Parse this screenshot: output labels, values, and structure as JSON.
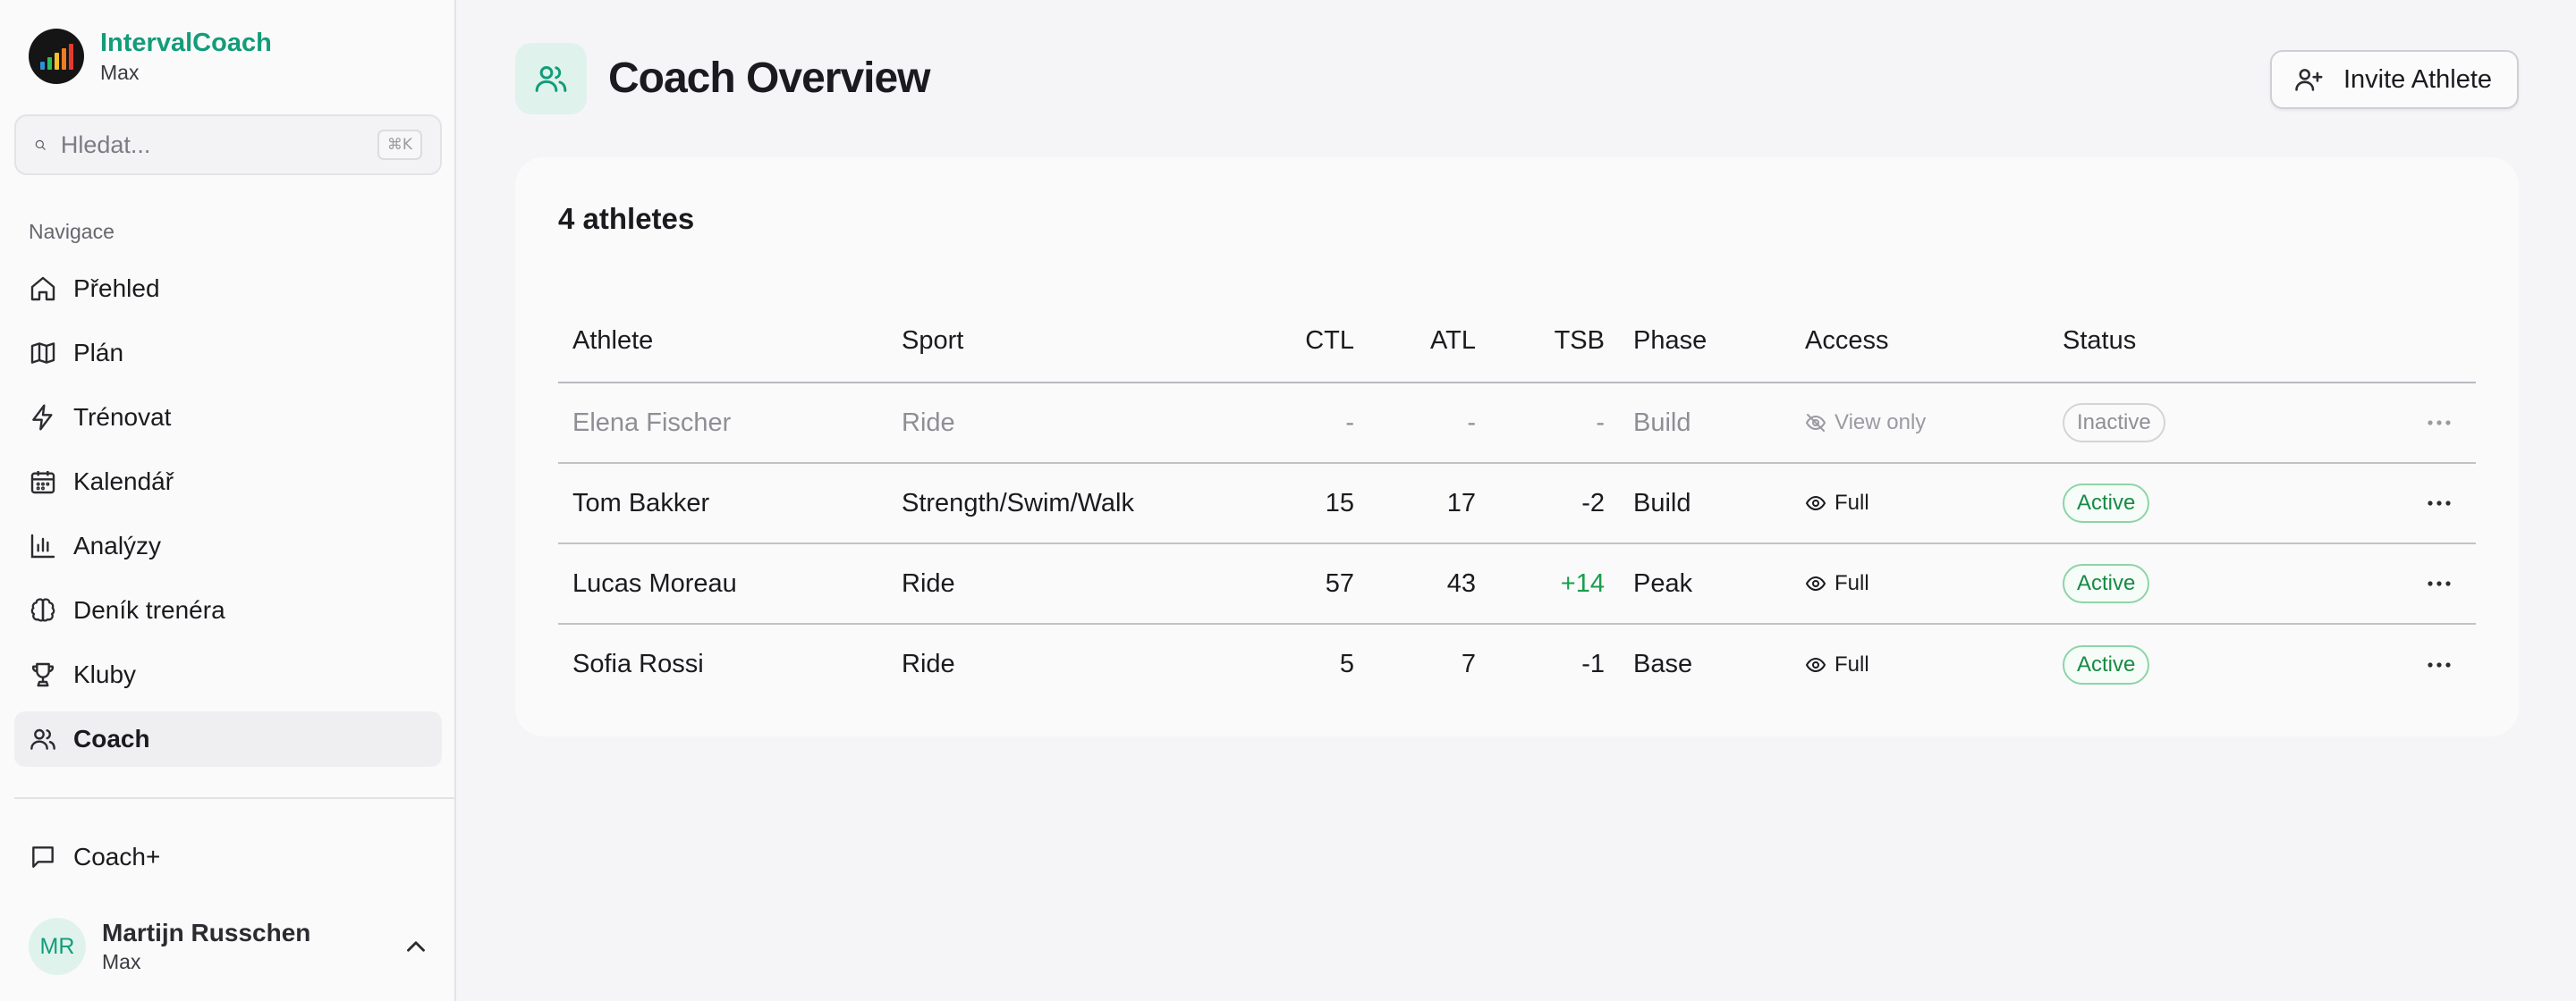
{
  "brand": {
    "name": "IntervalCoach",
    "subtitle": "Max"
  },
  "search": {
    "placeholder": "Hledat...",
    "shortcut": "⌘K"
  },
  "sidebar": {
    "heading": "Navigace",
    "items": [
      {
        "label": "Přehled",
        "icon": "home-icon"
      },
      {
        "label": "Plán",
        "icon": "map-icon"
      },
      {
        "label": "Trénovat",
        "icon": "bolt-icon"
      },
      {
        "label": "Kalendář",
        "icon": "calendar-icon"
      },
      {
        "label": "Analýzy",
        "icon": "bar-chart-icon"
      },
      {
        "label": "Deník trenéra",
        "icon": "brain-icon"
      },
      {
        "label": "Kluby",
        "icon": "trophy-icon"
      },
      {
        "label": "Coach",
        "icon": "users-icon",
        "active": true
      }
    ],
    "coach_plus": "Coach+"
  },
  "user": {
    "initials": "MR",
    "name": "Martijn Russchen",
    "subtitle": "Max"
  },
  "header": {
    "title": "Coach Overview",
    "invite_label": "Invite Athlete"
  },
  "card": {
    "title": "4 athletes"
  },
  "table": {
    "columns": [
      "Athlete",
      "Sport",
      "CTL",
      "ATL",
      "TSB",
      "Phase",
      "Access",
      "Status"
    ],
    "rows": [
      {
        "athlete": "Elena Fischer",
        "sport": "Ride",
        "ctl": "-",
        "atl": "-",
        "tsb": "-",
        "phase": "Build",
        "access": "View only",
        "status": "Inactive"
      },
      {
        "athlete": "Tom Bakker",
        "sport": "Strength/Swim/Walk",
        "ctl": "15",
        "atl": "17",
        "tsb": "-2",
        "phase": "Build",
        "access": "Full",
        "status": "Active"
      },
      {
        "athlete": "Lucas Moreau",
        "sport": "Ride",
        "ctl": "57",
        "atl": "43",
        "tsb": "+14",
        "phase": "Peak",
        "access": "Full",
        "status": "Active"
      },
      {
        "athlete": "Sofia Rossi",
        "sport": "Ride",
        "ctl": "5",
        "atl": "7",
        "tsb": "-1",
        "phase": "Base",
        "access": "Full",
        "status": "Active"
      }
    ]
  },
  "colors": {
    "accent": "#139c7a",
    "positive": "#1a9d4e",
    "active_badge": "#178a45"
  }
}
